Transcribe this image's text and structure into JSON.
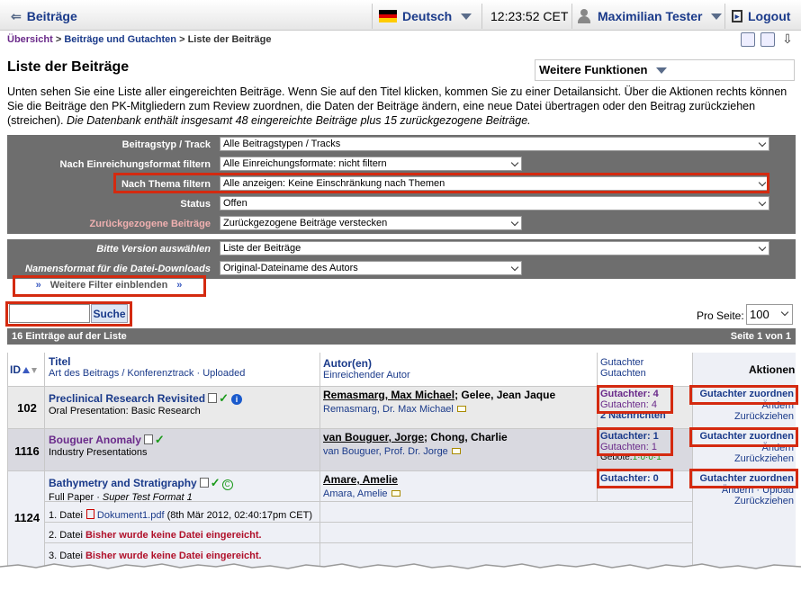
{
  "topbar": {
    "back_label": "Beiträge",
    "language": "Deutsch",
    "time": "12:23:52 CET",
    "user": "Maximilian Tester",
    "logout": "Logout"
  },
  "breadcrumb": {
    "home": "Übersicht",
    "sep1": ">",
    "section": "Beiträge und Gutachten",
    "sep2": ">",
    "current": "Liste der Beiträge"
  },
  "page": {
    "title": "Liste der Beiträge",
    "more_functions": "Weitere Funktionen",
    "intro_text": "Unten sehen Sie eine Liste aller eingereichten Beiträge. Wenn Sie auf den Titel klicken, kommen Sie zu einer Detailansicht. Über die Aktionen rechts können Sie die Beiträge den PK-Mitgliedern zum Review zuordnen, die Daten der Beiträge ändern, eine neue Datei übertragen oder den Beitrag zurückziehen (streichen).",
    "intro_italic": "Die Datenbank enthält insgesamt 48 eingereichte Beiträge plus 15 zurückgezogene Beiträge."
  },
  "filters": [
    {
      "label": "Beitragstyp / Track",
      "value": "Alle Beitragstypen / Tracks"
    },
    {
      "label": "Nach Einreichungsformat filtern",
      "value": "Alle Einreichungsformate: nicht filtern"
    },
    {
      "label": "Nach Thema filtern",
      "value": "Alle anzeigen: Keine Einschränkung nach Themen"
    },
    {
      "label": "Status",
      "value": "Offen"
    },
    {
      "label": "Zurückgezogene Beiträge",
      "value": "Zurückgezogene Beiträge verstecken"
    },
    {
      "label": "Bitte Version auswählen",
      "value": "Liste der Beiträge"
    },
    {
      "label": "Namensformat für die Datei-Downloads",
      "value": "Original-Dateiname des Autors"
    }
  ],
  "more_filters": "Weitere Filter einblenden",
  "search": {
    "placeholder": "",
    "button": "Suche"
  },
  "per_page": {
    "label": "Pro Seite:",
    "value": "100"
  },
  "list_bar": {
    "count": "16 Einträge auf der Liste",
    "page": "Seite 1 von 1"
  },
  "table": {
    "headers": {
      "id": "ID",
      "title": "Titel",
      "title_sub": "Art des Beitrags / Konferenztrack",
      "uploaded": "Uploaded",
      "dot": "·",
      "author": "Autor(en)",
      "author_sub": "Einreichender Autor",
      "reviewer1": "Gutachter",
      "reviewer2": "Gutachten",
      "actions": "Aktionen"
    },
    "rows": [
      {
        "id": "102",
        "title": "Preclinical Research Revisited",
        "type": "Oral Presentation: Basic Research",
        "authors_main": "Remasmarg, Max Michael",
        "authors_rest": "; Gelee, Jean Jaque",
        "submitter": "Remasmarg, Dr. Max Michael",
        "reviewers": "Gutachter: 4",
        "reviews": "Gutachten: 4",
        "messages": "2 Nachrichten",
        "assign": "Gutachter zuordnen",
        "change": "Ändern",
        "withdraw": "Zurückziehen"
      },
      {
        "id": "1116",
        "title": "Bouguer Anomaly",
        "type": "Industry Presentations",
        "authors_main": "van Bouguer, Jorge",
        "authors_rest": "; Chong, Charlie",
        "submitter": "van Bouguer, Prof. Dr. Jorge",
        "reviewers": "Gutachter: 1",
        "reviews": "Gutachten: 1",
        "bids_label": "Gebote:",
        "bids_value": "1·0·0·1",
        "assign": "Gutachter zuordnen",
        "change": "Ändern",
        "withdraw": "Zurückziehen"
      },
      {
        "id": "1124",
        "title": "Bathymetry and Stratigraphy",
        "type": "Full Paper",
        "format": "Super Test Format 1",
        "authors_main": "Amare, Amelie",
        "submitter": "Amara, Amelie",
        "reviewers": "Gutachter: 0",
        "assign": "Gutachter zuordnen",
        "change": "Ändern",
        "upload": "Upload",
        "withdraw": "Zurückziehen",
        "files": [
          {
            "prefix": "1. Datei",
            "name": "Dokument1.pdf",
            "date": "(8th Mär 2012, 02:40:17pm CET)"
          },
          {
            "prefix": "2. Datei",
            "missing": "Bisher wurde keine Datei eingereicht."
          },
          {
            "prefix": "3. Datei",
            "missing": "Bisher wurde keine Datei eingereicht."
          }
        ]
      }
    ]
  },
  "colors": {
    "highlight": "#d42a10",
    "filter_bg": "#6e6e6e",
    "link": "#1a3a8a"
  }
}
